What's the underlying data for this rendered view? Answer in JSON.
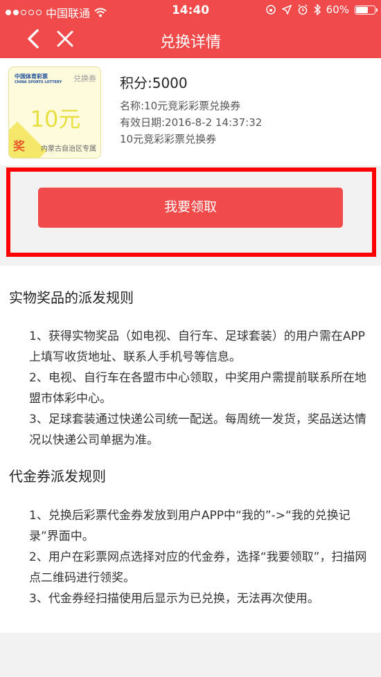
{
  "statusbar": {
    "carrier": "中国联通",
    "time": "14:40",
    "battery": "60%"
  },
  "navbar": {
    "title": "兑换详情"
  },
  "coupon": {
    "logo_cn": "中国体育彩票",
    "logo_en": "CHINA SPORTS LOTTERY",
    "type_label": "兑换券",
    "amount": "10元",
    "prize_char": "奖",
    "region": "内蒙古自治区专属"
  },
  "info": {
    "points": "积分:5000",
    "name": "名称:10元竞彩彩票兑换券",
    "expiry": "有效日期:2016-8-2 14:37:32",
    "description": "10元竞彩彩票兑换券"
  },
  "claim_button": "我要领取",
  "rules": {
    "physical_title": "实物奖品的派发规则",
    "physical_items": [
      "1、获得实物奖品（如电视、自行车、足球套装）的用户需在APP上填写收货地址、联系人手机号等信息。",
      "2、电视、自行车在各盟市中心领取，中奖用户需提前联系所在地盟市体彩中心。",
      "3、足球套装通过快递公司统一配送。每周统一发货，奖品送达情况以快递公司单据为准。"
    ],
    "voucher_title": "代金券派发规则",
    "voucher_items": [
      "1、兑换后彩票代金券发放到用户APP中“我的”->“我的兑换记录”界面中。",
      "2、用户在彩票网点选择对应的代金券，选择“我要领取”，扫描网点二维码进行领奖。",
      "3、代金券经扫描使用后显示为已兑换，无法再次使用。"
    ]
  }
}
